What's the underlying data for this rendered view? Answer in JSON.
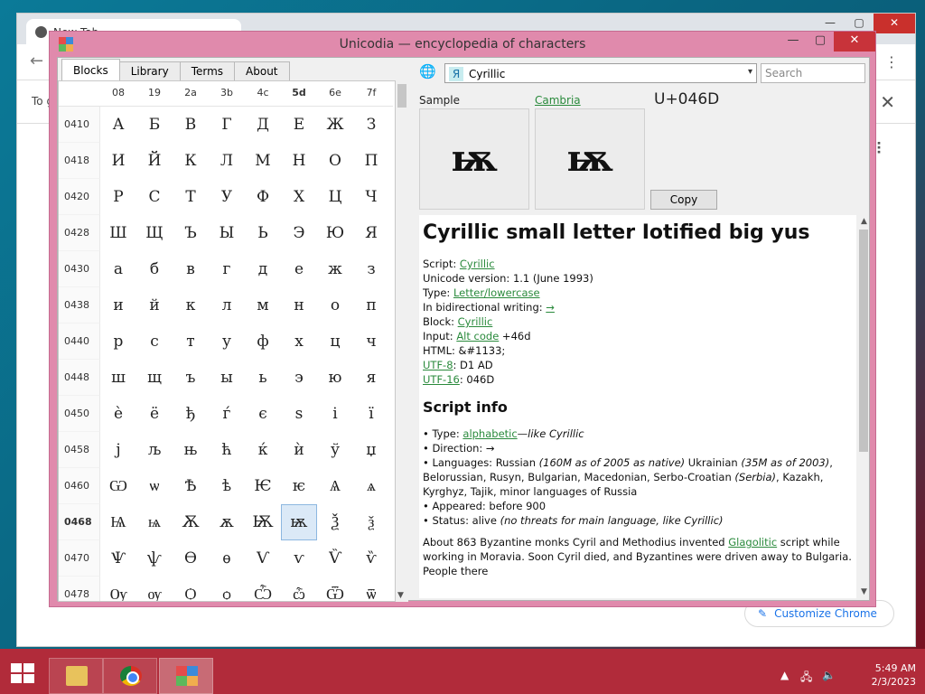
{
  "chrome": {
    "tab_title": "New Tab",
    "infobar_text": "To g",
    "customize_label": "Customize Chrome"
  },
  "app": {
    "title": "Unicodia — encyclopedia of characters",
    "tabs": [
      "Blocks",
      "Library",
      "Terms",
      "About"
    ],
    "active_tab": "Blocks",
    "grid": {
      "columns": [
        "08",
        "19",
        "2a",
        "3b",
        "4c",
        "5d",
        "6e",
        "7f"
      ],
      "current_column": "5d",
      "rows": [
        {
          "code": "0410",
          "chars": [
            "А",
            "Б",
            "В",
            "Г",
            "Д",
            "Е",
            "Ж",
            "З"
          ]
        },
        {
          "code": "0418",
          "chars": [
            "И",
            "Й",
            "К",
            "Л",
            "М",
            "Н",
            "О",
            "П"
          ]
        },
        {
          "code": "0420",
          "chars": [
            "Р",
            "С",
            "Т",
            "У",
            "Ф",
            "Х",
            "Ц",
            "Ч"
          ]
        },
        {
          "code": "0428",
          "chars": [
            "Ш",
            "Щ",
            "Ъ",
            "Ы",
            "Ь",
            "Э",
            "Ю",
            "Я"
          ]
        },
        {
          "code": "0430",
          "chars": [
            "а",
            "б",
            "в",
            "г",
            "д",
            "е",
            "ж",
            "з"
          ]
        },
        {
          "code": "0438",
          "chars": [
            "и",
            "й",
            "к",
            "л",
            "м",
            "н",
            "о",
            "п"
          ]
        },
        {
          "code": "0440",
          "chars": [
            "р",
            "с",
            "т",
            "у",
            "ф",
            "х",
            "ц",
            "ч"
          ]
        },
        {
          "code": "0448",
          "chars": [
            "ш",
            "щ",
            "ъ",
            "ы",
            "ь",
            "э",
            "ю",
            "я"
          ]
        },
        {
          "code": "0450",
          "chars": [
            "ѐ",
            "ё",
            "ђ",
            "ѓ",
            "є",
            "ѕ",
            "і",
            "ї"
          ]
        },
        {
          "code": "0458",
          "chars": [
            "ј",
            "љ",
            "њ",
            "ћ",
            "ќ",
            "ѝ",
            "ў",
            "џ"
          ]
        },
        {
          "code": "0460",
          "chars": [
            "Ѡ",
            "ѡ",
            "Ѣ",
            "ѣ",
            "Ѥ",
            "ѥ",
            "Ѧ",
            "ѧ"
          ]
        },
        {
          "code": "0468",
          "chars": [
            "Ѩ",
            "ѩ",
            "Ѫ",
            "ѫ",
            "Ѭ",
            "ѭ",
            "Ѯ",
            "ѯ"
          ]
        },
        {
          "code": "0470",
          "chars": [
            "Ѱ",
            "ѱ",
            "Ѳ",
            "ѳ",
            "Ѵ",
            "ѵ",
            "Ѷ",
            "ѷ"
          ]
        },
        {
          "code": "0478",
          "chars": [
            "Ѹ",
            "ѹ",
            "Ѻ",
            "ѻ",
            "Ѽ",
            "ѽ",
            "Ѿ",
            "ѿ"
          ]
        }
      ],
      "selected_row_code": "0468",
      "selected_col_index": 5
    },
    "block_select": {
      "icon_char": "Я",
      "value": "Cyrillic"
    },
    "search_placeholder": "Search",
    "sample_label": "Sample",
    "font_label": "Cambria",
    "code_point": "U+046D",
    "sample_char": "ѭ",
    "copy_label": "Copy",
    "info": {
      "heading": "Cyrillic small letter Iotified big yus",
      "props": [
        {
          "k": "Script: ",
          "v": "Cyrillic",
          "link": true,
          "after": ""
        },
        {
          "k": "Unicode version: 1.1 (June 1993)",
          "v": "",
          "link": false,
          "after": ""
        },
        {
          "k": "Type: ",
          "v": "Letter/lowercase",
          "link": true,
          "after": ""
        },
        {
          "k": "In bidirectional writing: ",
          "v": "→",
          "link": true,
          "after": ""
        },
        {
          "k": "Block: ",
          "v": "Cyrillic",
          "link": true,
          "after": ""
        },
        {
          "k": "Input: ",
          "v": "Alt code",
          "link": true,
          "after": " +46d"
        },
        {
          "k": "HTML: &#1133;",
          "v": "",
          "link": false,
          "after": ""
        },
        {
          "k": "",
          "v": "UTF-8",
          "link": true,
          "after": ": D1 AD"
        },
        {
          "k": "",
          "v": "UTF-16",
          "link": true,
          "after": ": 046D"
        }
      ],
      "script_heading": "Script info",
      "script_type_prefix": "• Type: ",
      "script_type_link": "alphabetic",
      "script_type_suffix": "—like Cyrillic",
      "direction": "• Direction: →",
      "languages_1": "• Languages: Russian ",
      "languages_1i": "(160M as of 2005 as native)",
      "languages_2": " Ukrainian ",
      "languages_2i": "(35M as of 2003)",
      "languages_3": ", Belorussian, Rusyn, Bulgarian, Macedonian, Serbo-Croatian ",
      "languages_3i": "(Serbia)",
      "languages_4": ", Kazakh, Kyrghyz, Tajik, minor languages of Russia",
      "appeared": "• Appeared: before 900",
      "status": "• Status: alive ",
      "status_i": "(no threats for main language, like Cyrillic)",
      "about_1": "About 863 Byzantine monks Cyril and Methodius invented ",
      "about_link": "Glagolitic",
      "about_2": " script while working in Moravia. Soon Cyril died, and Byzantines were driven away to Bulgaria. People there"
    }
  },
  "taskbar": {
    "time": "5:49 AM",
    "date": "2/3/2023"
  }
}
